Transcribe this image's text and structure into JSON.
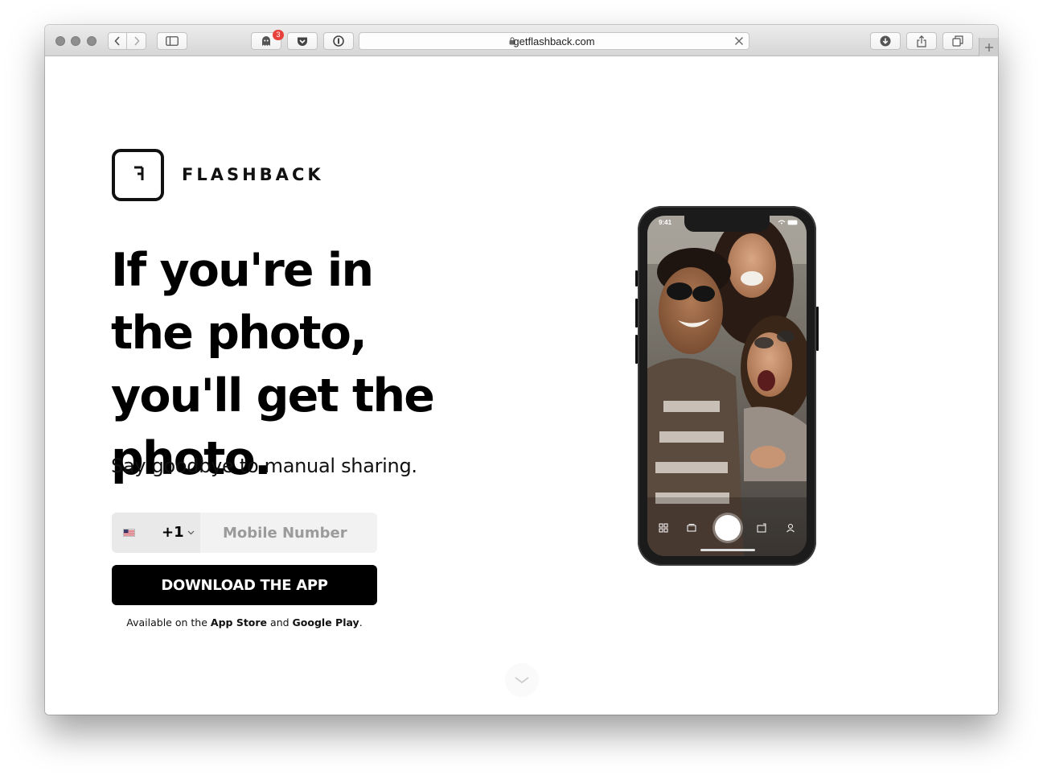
{
  "browser": {
    "url": "getflashback.com",
    "extension_badge_count": "3"
  },
  "brand": {
    "logo_mark": "F",
    "wordmark": "FLASHBACK"
  },
  "hero": {
    "headline": "If you're in the photo, you'll get the photo.",
    "subheadline": "Say goodbye to manual sharing."
  },
  "signup": {
    "country_flag": "us-flag-icon",
    "country_code": "+1",
    "mobile_placeholder": "Mobile Number",
    "mobile_value": "",
    "download_label": "DOWNLOAD THE APP",
    "availability_prefix": "Available on the",
    "store_1": "App Store",
    "conjunction": "and",
    "store_2": "Google Play",
    "availability_suffix": "."
  },
  "phone_mockup": {
    "status_time": "9:41"
  },
  "colors": {
    "primary": "#000000",
    "button_text": "#ffffff",
    "input_bg": "#f2f2f2",
    "placeholder": "#9b9b9b",
    "badge": "#e8403b"
  },
  "icons": {
    "scroll": "chevron-down-icon"
  }
}
